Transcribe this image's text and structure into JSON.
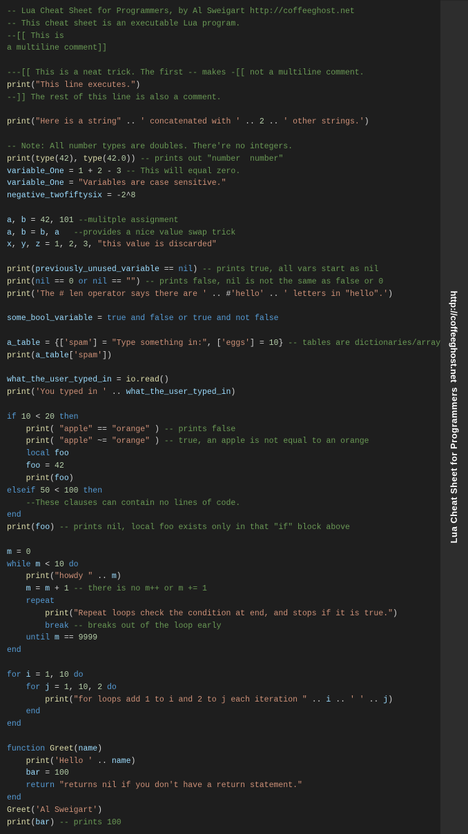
{
  "sidebar": {
    "line1": "Lua Cheat Sheet for Programmers",
    "line2": "http://coffeeghost.net"
  },
  "code": {
    "title": "Lua Cheat Sheet for Programmers"
  }
}
